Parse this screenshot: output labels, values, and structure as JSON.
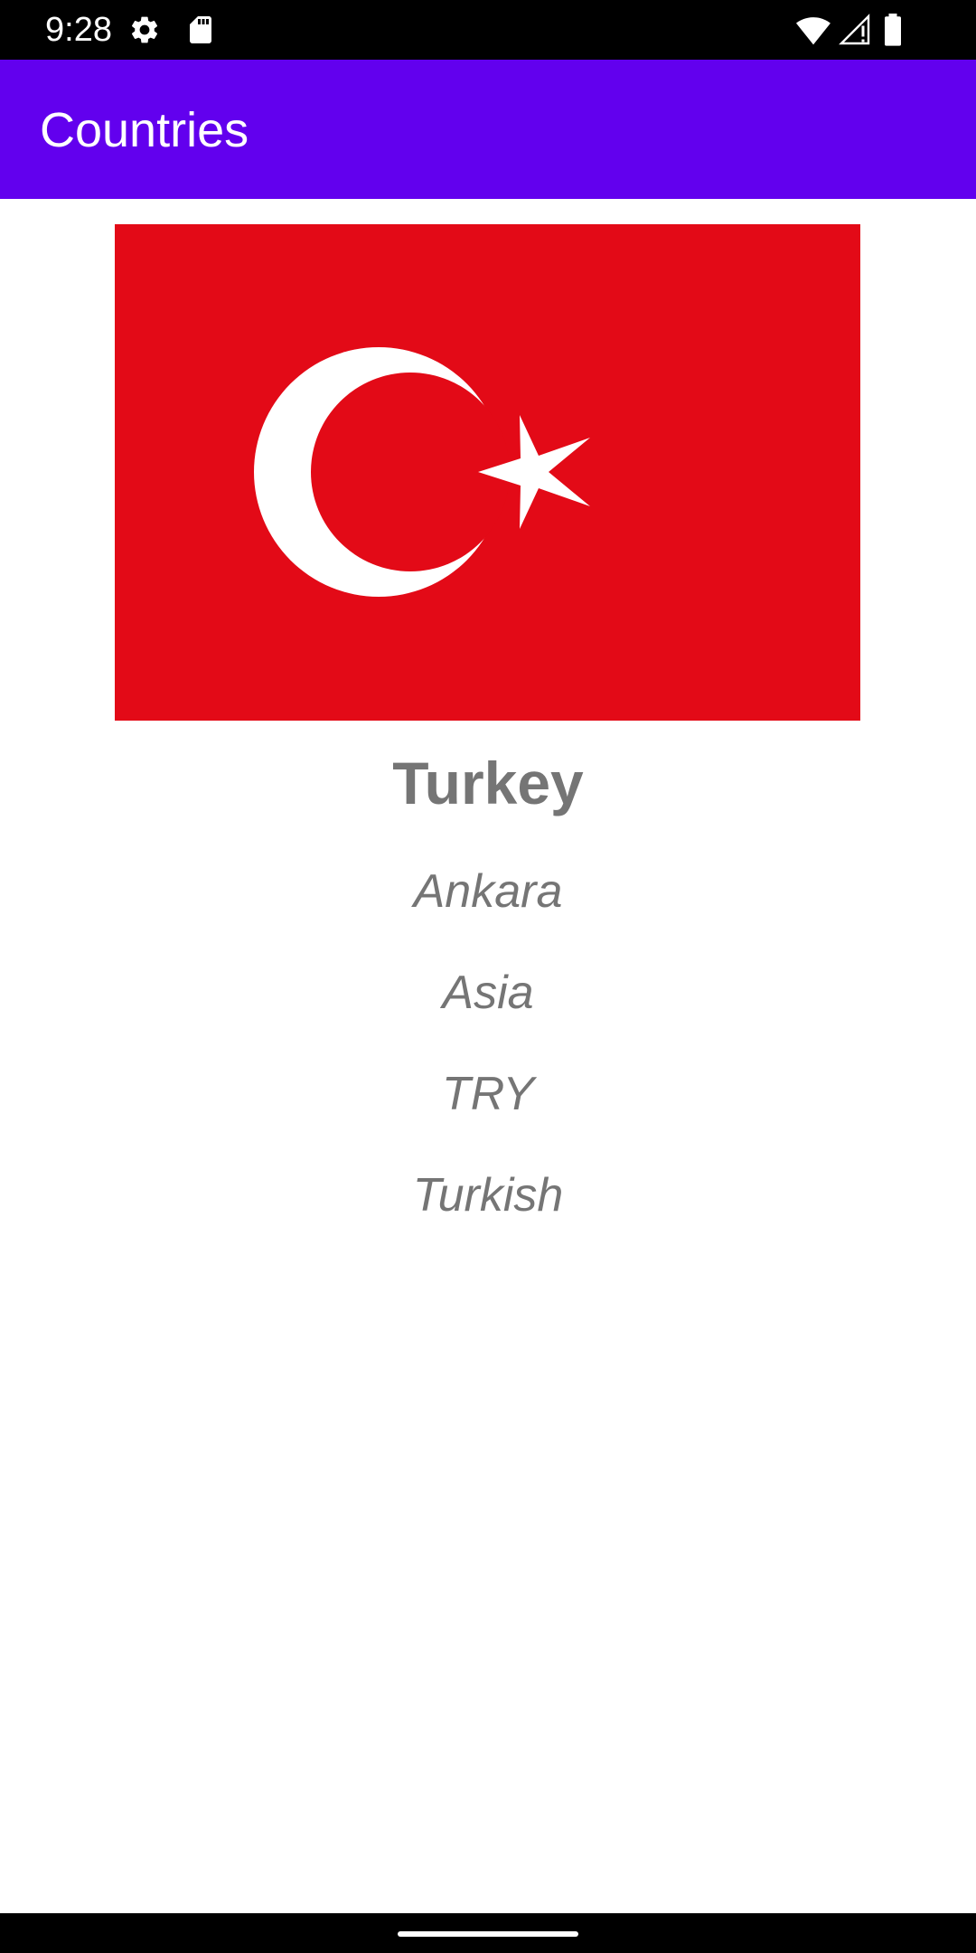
{
  "status_bar": {
    "time": "9:28",
    "icons": [
      "settings-icon",
      "sd-card-icon",
      "wifi-icon",
      "signal-icon",
      "battery-icon"
    ]
  },
  "app_bar": {
    "title": "Countries",
    "color": "#6200ee"
  },
  "country": {
    "name": "Turkey",
    "capital": "Ankara",
    "region": "Asia",
    "currency": "TRY",
    "language": "Turkish",
    "flag": {
      "icon": "turkey-flag",
      "background_color": "#e30a17",
      "symbol_color": "#ffffff"
    }
  },
  "colors": {
    "text_secondary": "#757575",
    "status_bar": "#000000"
  }
}
